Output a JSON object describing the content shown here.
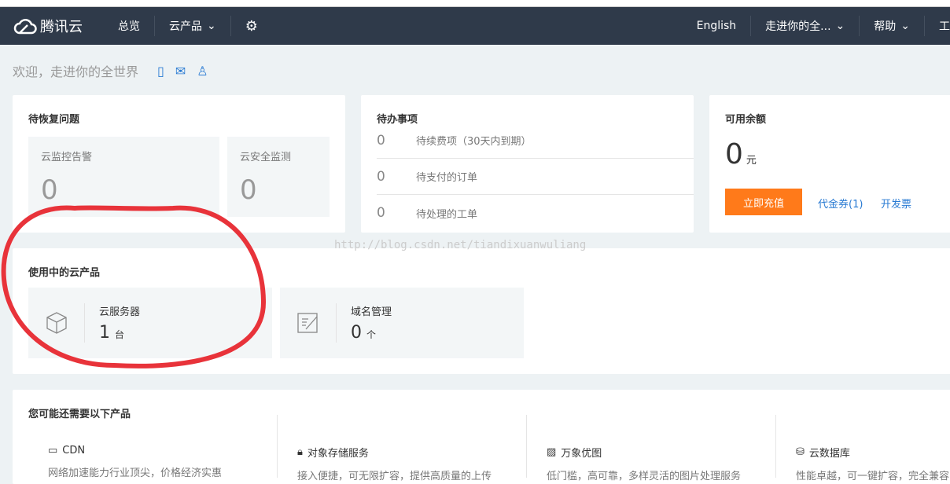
{
  "nav": {
    "brand": "腾讯云",
    "overview": "总览",
    "products": "云产品",
    "english": "English",
    "account": "走进你的全...",
    "help": "帮助",
    "more": "工"
  },
  "welcome": "欢迎，走进你的全世界",
  "pending_issues": {
    "title": "待恢复问题",
    "tiles": [
      {
        "label": "云监控告警",
        "count": "0"
      },
      {
        "label": "云安全监测",
        "count": "0"
      }
    ]
  },
  "todo": {
    "title": "待办事项",
    "items": [
      {
        "count": "0",
        "label": "待续费项（30天内到期）"
      },
      {
        "count": "0",
        "label": "待支付的订单"
      },
      {
        "count": "0",
        "label": "待处理的工单"
      }
    ]
  },
  "balance": {
    "title": "可用余额",
    "amount": "0",
    "unit": "元",
    "recharge": "立即充值",
    "voucher": "代金券(1)",
    "invoice": "开发票"
  },
  "in_use": {
    "title": "使用中的云产品",
    "items": [
      {
        "name": "云服务器",
        "count": "1",
        "unit": "台"
      },
      {
        "name": "域名管理",
        "count": "0",
        "unit": "个"
      }
    ]
  },
  "recommend": {
    "title": "您可能还需要以下产品",
    "items": [
      {
        "name": "CDN",
        "desc": "网络加速能力行业顶尖，价格经济实惠"
      },
      {
        "name": "对象存储服务",
        "desc": "接入便捷，可无限扩容，提供高质量的上传"
      },
      {
        "name": "万象优图",
        "desc": "低门槛，高可靠，多样灵活的图片处理服务"
      },
      {
        "name": "云数据库",
        "desc": "性能卓越，可一键扩容，完全兼容"
      }
    ]
  },
  "watermark": "http://blog.csdn.net/tiandixuanwuliang",
  "colors": {
    "nav": "#2f3a4a",
    "accent": "#ff7a1a",
    "link": "#2a7bd3",
    "annotation": "#e8333a"
  }
}
